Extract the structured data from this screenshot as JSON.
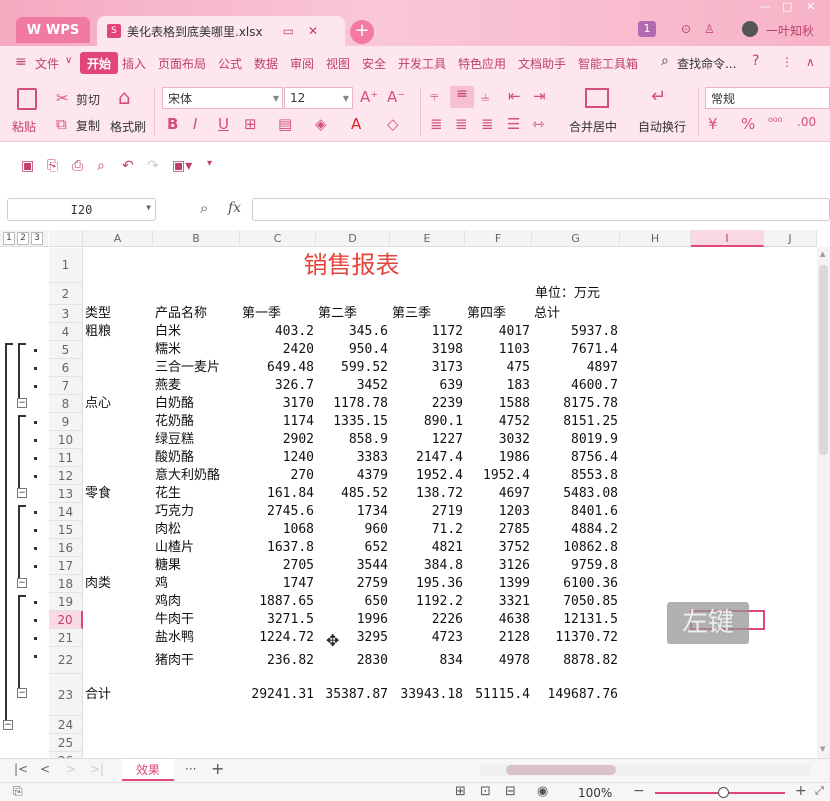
{
  "titlebar": {
    "app_label": "WPS",
    "doc_tab_title": "美化表格到底美哪里.xlsx",
    "badge_count": "1",
    "user_name": "一叶知秋"
  },
  "menu": {
    "file": "文件",
    "items": [
      "开始",
      "插入",
      "页面布局",
      "公式",
      "数据",
      "审阅",
      "视图",
      "安全",
      "开发工具",
      "特色应用",
      "文档助手",
      "智能工具箱"
    ],
    "search_label": "查找命令...",
    "help": "?"
  },
  "ribbon": {
    "paste": "粘贴",
    "cut": "剪切",
    "copy": "复制",
    "format_painter": "格式刷",
    "font_name": "宋体",
    "font_size": "12",
    "merge_center": "合并居中",
    "wrap_text": "自动换行",
    "number_format": "常规"
  },
  "formula_bar": {
    "name_box": "I20",
    "fx": "fx",
    "formula": ""
  },
  "grid": {
    "outline_levels": [
      "1",
      "2",
      "3"
    ],
    "columns": [
      "A",
      "B",
      "C",
      "D",
      "E",
      "F",
      "G",
      "H",
      "I",
      "J"
    ],
    "selected_column": "I",
    "selected_row": "20",
    "title": "销售报表",
    "unit": "单位：万元",
    "headers": [
      "类型",
      "产品名称",
      "第一季",
      "第二季",
      "第三季",
      "第四季",
      "总计"
    ],
    "rows": [
      {
        "row": "4",
        "type": "粗粮",
        "name": "白米",
        "q1": "403.2",
        "q2": "345.6",
        "q3": "1172",
        "q4": "4017",
        "total": "5937.8"
      },
      {
        "row": "5",
        "type": "",
        "name": "糯米",
        "q1": "2420",
        "q2": "950.4",
        "q3": "3198",
        "q4": "1103",
        "total": "7671.4"
      },
      {
        "row": "6",
        "type": "",
        "name": "三合一麦片",
        "q1": "649.48",
        "q2": "599.52",
        "q3": "3173",
        "q4": "475",
        "total": "4897"
      },
      {
        "row": "7",
        "type": "",
        "name": "燕麦",
        "q1": "326.7",
        "q2": "3452",
        "q3": "639",
        "q4": "183",
        "total": "4600.7"
      },
      {
        "row": "8",
        "type": "点心",
        "name": "白奶酪",
        "q1": "3170",
        "q2": "1178.78",
        "q3": "2239",
        "q4": "1588",
        "total": "8175.78"
      },
      {
        "row": "9",
        "type": "",
        "name": "花奶酪",
        "q1": "1174",
        "q2": "1335.15",
        "q3": "890.1",
        "q4": "4752",
        "total": "8151.25"
      },
      {
        "row": "10",
        "type": "",
        "name": "绿豆糕",
        "q1": "2902",
        "q2": "858.9",
        "q3": "1227",
        "q4": "3032",
        "total": "8019.9"
      },
      {
        "row": "11",
        "type": "",
        "name": "酸奶酪",
        "q1": "1240",
        "q2": "3383",
        "q3": "2147.4",
        "q4": "1986",
        "total": "8756.4"
      },
      {
        "row": "12",
        "type": "",
        "name": "意大利奶酪",
        "q1": "270",
        "q2": "4379",
        "q3": "1952.4",
        "q4": "1952.4",
        "total": "8553.8"
      },
      {
        "row": "13",
        "type": "零食",
        "name": "花生",
        "q1": "161.84",
        "q2": "485.52",
        "q3": "138.72",
        "q4": "4697",
        "total": "5483.08"
      },
      {
        "row": "14",
        "type": "",
        "name": "巧克力",
        "q1": "2745.6",
        "q2": "1734",
        "q3": "2719",
        "q4": "1203",
        "total": "8401.6"
      },
      {
        "row": "15",
        "type": "",
        "name": "肉松",
        "q1": "1068",
        "q2": "960",
        "q3": "71.2",
        "q4": "2785",
        "total": "4884.2"
      },
      {
        "row": "16",
        "type": "",
        "name": "山楂片",
        "q1": "1637.8",
        "q2": "652",
        "q3": "4821",
        "q4": "3752",
        "total": "10862.8"
      },
      {
        "row": "17",
        "type": "",
        "name": "糖果",
        "q1": "2705",
        "q2": "3544",
        "q3": "384.8",
        "q4": "3126",
        "total": "9759.8"
      },
      {
        "row": "18",
        "type": "肉类",
        "name": "鸡",
        "q1": "1747",
        "q2": "2759",
        "q3": "195.36",
        "q4": "1399",
        "total": "6100.36"
      },
      {
        "row": "19",
        "type": "",
        "name": "鸡肉",
        "q1": "1887.65",
        "q2": "650",
        "q3": "1192.2",
        "q4": "3321",
        "total": "7050.85"
      },
      {
        "row": "20",
        "type": "",
        "name": "牛肉干",
        "q1": "3271.5",
        "q2": "1996",
        "q3": "2226",
        "q4": "4638",
        "total": "12131.5"
      },
      {
        "row": "21",
        "type": "",
        "name": "盐水鸭",
        "q1": "1224.72",
        "q2": "3295",
        "q3": "4723",
        "q4": "2128",
        "total": "11370.72"
      },
      {
        "row": "22",
        "type": "",
        "name": "猪肉干",
        "q1": "236.82",
        "q2": "2830",
        "q3": "834",
        "q4": "4978",
        "total": "8878.82"
      },
      {
        "row": "23",
        "type": "合计",
        "name": "",
        "q1": "29241.31",
        "q2": "35387.87",
        "q3": "33943.18",
        "q4": "51115.4",
        "total": "149687.76"
      }
    ],
    "extra_rows": [
      "24",
      "25"
    ]
  },
  "sheetbar": {
    "active_sheet": "效果",
    "more": "···",
    "add": "+"
  },
  "statusbar": {
    "zoom": "100%"
  },
  "overlay": {
    "mouse_hint": "左键"
  },
  "colors": {
    "accent": "#e2457a",
    "title_red": "#e2453c",
    "ribbon_bg": "#fde6ee",
    "titlebar_bg": "#f7b3c7"
  }
}
